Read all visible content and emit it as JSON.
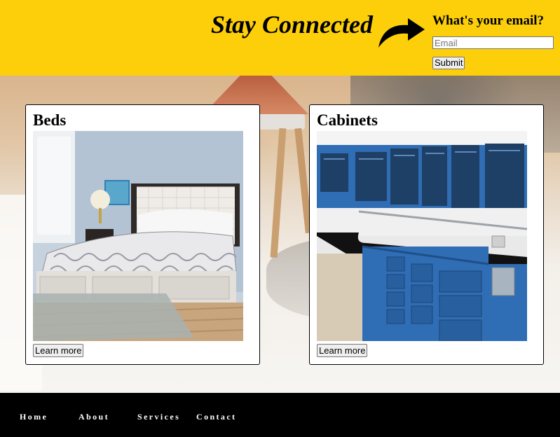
{
  "header": {
    "title": "Stay Connected",
    "email_question": "What's your email?",
    "email_value": "",
    "email_placeholder": "Email",
    "submit_label": "Submit"
  },
  "cards": [
    {
      "title": "Beds",
      "button_label": "Learn more",
      "image": "bed-photo"
    },
    {
      "title": "Cabinets",
      "button_label": "Learn more",
      "image": "cabinets-photo"
    }
  ],
  "footer": {
    "nav": [
      {
        "label": "Home"
      },
      {
        "label": "About"
      },
      {
        "label": "Services"
      },
      {
        "label": "Contact"
      }
    ]
  },
  "colors": {
    "header_bg": "#fccf0a",
    "footer_bg": "#000000",
    "cabinet_blue": "#2f6db5"
  },
  "icons": {
    "arrow": "curved-arrow-icon"
  }
}
